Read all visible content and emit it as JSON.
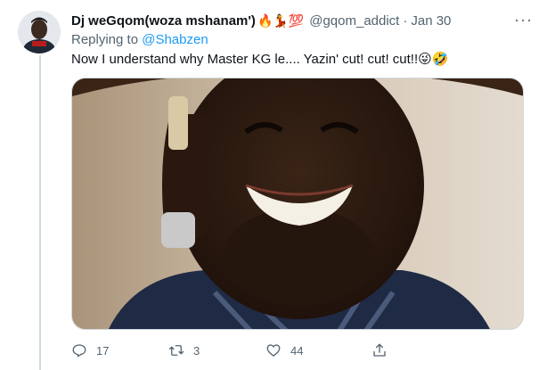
{
  "tweet": {
    "display_name": "Dj weGqom(woza mshanam')",
    "name_emojis": "🔥💃💯",
    "handle": "@gqom_addict",
    "separator": "·",
    "time": "Jan 30",
    "more_label": "···",
    "replying_prefix": "Replying to",
    "replying_handle": "@Shabzen",
    "text": "Now I understand why Master KG le.... Yazin' cut! cut! cut!!😜🤣"
  },
  "actions": {
    "reply_count": "17",
    "retweet_count": "3",
    "like_count": "44"
  },
  "icons": {
    "reply": "reply-icon",
    "retweet": "retweet-icon",
    "like": "heart-icon",
    "share": "share-icon"
  },
  "colors": {
    "link": "#1d9bf0",
    "secondary": "#536471",
    "border": "#cfd9de"
  }
}
